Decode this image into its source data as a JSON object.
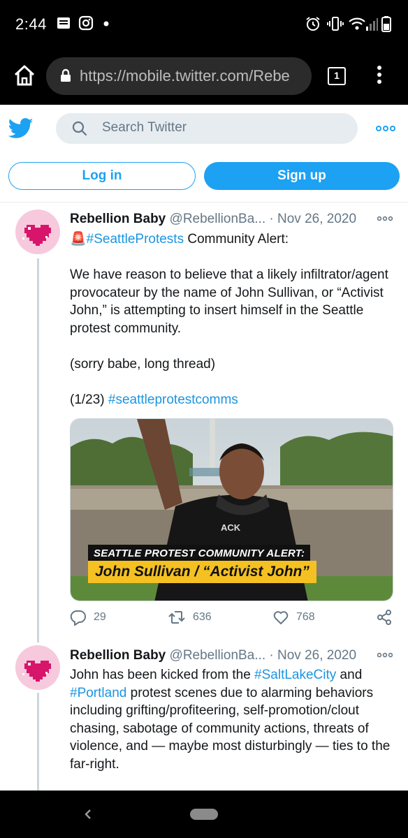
{
  "status_bar": {
    "time": "2:44",
    "icons": [
      "notes-icon",
      "instagram-icon",
      "dot-icon",
      "alarm-icon",
      "vibrate-icon",
      "wifi-icon",
      "signal-icon",
      "battery-icon"
    ]
  },
  "browser": {
    "url": "https://mobile.twitter.com/Rebe",
    "tab_count": "1"
  },
  "twitter_header": {
    "search_placeholder": "Search Twitter"
  },
  "auth": {
    "login_label": "Log in",
    "signup_label": "Sign up"
  },
  "colors": {
    "accent": "#1da1f2",
    "hashtag": "#1b95e0",
    "muted": "#657786"
  },
  "tweets": [
    {
      "name": "Rebellion Baby",
      "handle": "@RebellionBa...",
      "separator": "·",
      "date": "Nov 26, 2020",
      "siren": "🚨",
      "line1_hashtag": "#SeattleProtests",
      "line1_rest": " Community Alert:",
      "para2": "We have reason to believe that a likely infiltrator/agent provocateur by the name of John Sullivan, or “Activist John,” is attempting to insert himself in the Seattle protest community.",
      "para3": "(sorry babe, long thread)",
      "para4_count": "(1/23) ",
      "para4_hashtag": "#seattleprotestcomms",
      "media": {
        "alert_line": "SEATTLE PROTEST COMMUNITY ALERT:",
        "name_line": "John Sullivan / “Activist John”",
        "shirt_text": "ACK"
      },
      "replies": "29",
      "retweets": "636",
      "likes": "768"
    },
    {
      "name": "Rebellion Baby",
      "handle": "@RebellionBa...",
      "separator": "·",
      "date": "Nov 26, 2020",
      "text_a": "John has been kicked from the ",
      "hashtag_a": "#SaltLakeCity",
      "text_b": " and ",
      "hashtag_b": "#Portland",
      "text_c": " protest scenes due to alarming behaviors including grifting/profiteering, self-promotion/clout chasing, sabotage of community actions, threats of violence, and — maybe most disturbingly — ties to the far-right."
    }
  ]
}
